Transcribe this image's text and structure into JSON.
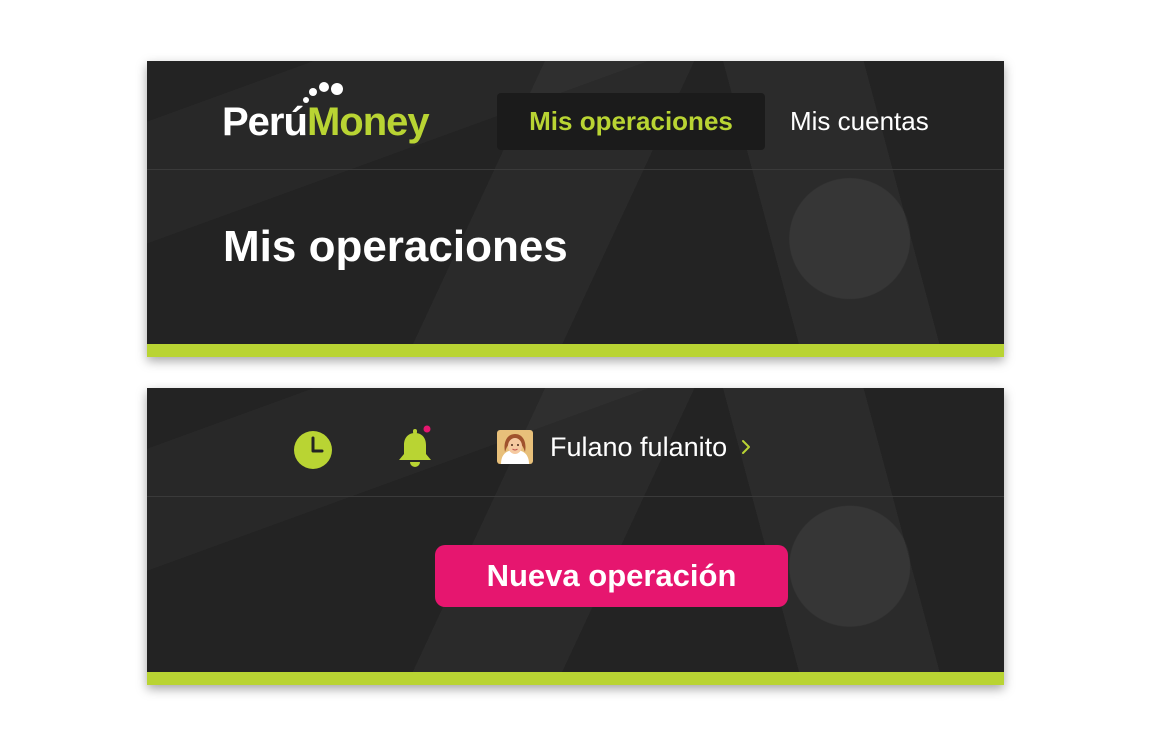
{
  "brand": {
    "name_part1": "Perú",
    "name_part2": "Money",
    "accent_color": "#b9d433"
  },
  "nav": {
    "items": [
      {
        "label": "Mis operaciones",
        "active": true
      },
      {
        "label": "Mis cuentas",
        "active": false
      }
    ]
  },
  "page": {
    "title": "Mis operaciones"
  },
  "toolbar": {
    "history_icon": "clock-icon",
    "notifications_icon": "bell-icon",
    "notification_dot_color": "#e6166f"
  },
  "user": {
    "name": "Fulano fulanito",
    "avatar_icon": "user-avatar",
    "chevron_icon": "chevron-right-icon"
  },
  "actions": {
    "new_operation_label": "Nueva operación",
    "new_operation_color": "#e6166f"
  }
}
